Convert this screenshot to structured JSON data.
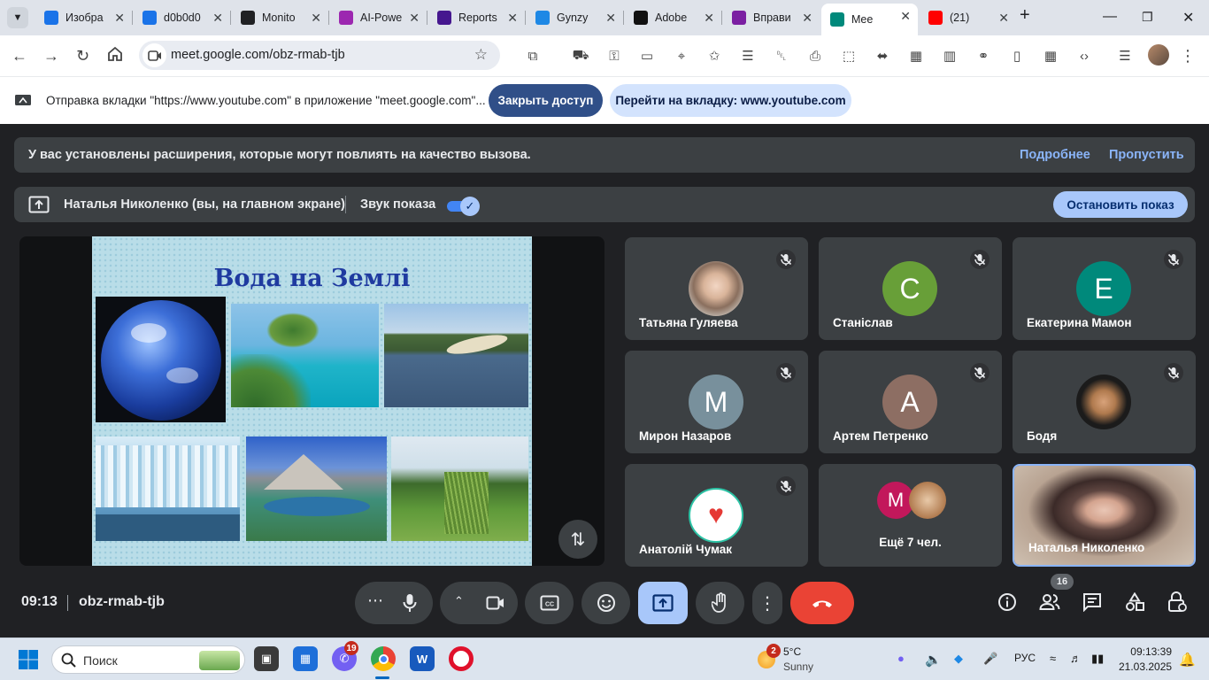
{
  "browser": {
    "tabs": [
      {
        "title": "Изобра",
        "icon": "search-icon",
        "color": "#1a73e8"
      },
      {
        "title": "d0b0d0",
        "icon": "search-icon",
        "color": "#1a73e8"
      },
      {
        "title": "Monito",
        "icon": "monitor-app-icon",
        "color": "#202124"
      },
      {
        "title": "AI-Powe",
        "icon": "quillbot-icon",
        "color": "#9c27b0"
      },
      {
        "title": "Reports",
        "icon": "kahoot-icon",
        "color": "#46178f"
      },
      {
        "title": "Gynzy",
        "icon": "gynzy-icon",
        "color": "#1e88e5"
      },
      {
        "title": "Adobe",
        "icon": "adobe-express-icon",
        "color": "#111"
      },
      {
        "title": "Вправи",
        "icon": "wordwall-icon",
        "color": "#7b1fa2"
      },
      {
        "title": "Mee",
        "icon": "google-meet-icon",
        "color": "#00897b",
        "active": true
      },
      {
        "title": "(21)",
        "icon": "youtube-icon",
        "color": "#ff0000"
      }
    ],
    "url": "meet.google.com/obz-rmab-tjb"
  },
  "infobar": {
    "text": "Отправка вкладки \"https://www.youtube.com\" в приложение \"meet.google.com\"...",
    "close_access": "Закрыть доступ",
    "goto_tab": "Перейти на вкладку: www.youtube.com"
  },
  "meet": {
    "warning": {
      "text": "У вас установлены расширения, которые могут повлиять на качество вызова.",
      "more": "Подробнее",
      "skip": "Пропустить"
    },
    "share_bar": {
      "presenter": "Наталья Николенко (вы, на главном экране)",
      "sound": "Звук показа",
      "sound_on": true,
      "stop": "Остановить показ"
    },
    "slide_title": "Вода на Землі",
    "participants": [
      {
        "name": "Татьяна Гуляева",
        "initial": "",
        "avatar_color": "#c9b7a4",
        "muted": true,
        "photo": true
      },
      {
        "name": "Станіслав",
        "initial": "С",
        "avatar_color": "#689f38",
        "muted": true
      },
      {
        "name": "Екатерина Мамон",
        "initial": "Е",
        "avatar_color": "#00897b",
        "muted": true
      },
      {
        "name": "Мирон Назаров",
        "initial": "М",
        "avatar_color": "#78909c",
        "muted": true
      },
      {
        "name": "Артем Петренко",
        "initial": "А",
        "avatar_color": "#8d6e63",
        "muted": true
      },
      {
        "name": "Бодя",
        "initial": "",
        "avatar_color": "#222",
        "muted": true,
        "photo": true
      },
      {
        "name": "Анатолій Чумак",
        "initial": "",
        "avatar_color": "#fff",
        "muted": true,
        "photo": true
      },
      {
        "name": "Ещё 7 чел.",
        "initial": "М",
        "avatar_color": "#c2185b",
        "muted": false
      },
      {
        "name": "Наталья Николенко",
        "initial": "",
        "avatar_color": "#6d5a55",
        "muted": false,
        "photo": true
      }
    ],
    "time": "09:13",
    "code": "obz-rmab-tjb",
    "participant_count": "16"
  },
  "taskbar": {
    "search": "Поиск",
    "viber_badge": "19",
    "weather_badge": "2",
    "temp": "5°C",
    "weather": "Sunny",
    "lang": "РУС",
    "time": "09:13:39",
    "date": "21.03.2025"
  }
}
